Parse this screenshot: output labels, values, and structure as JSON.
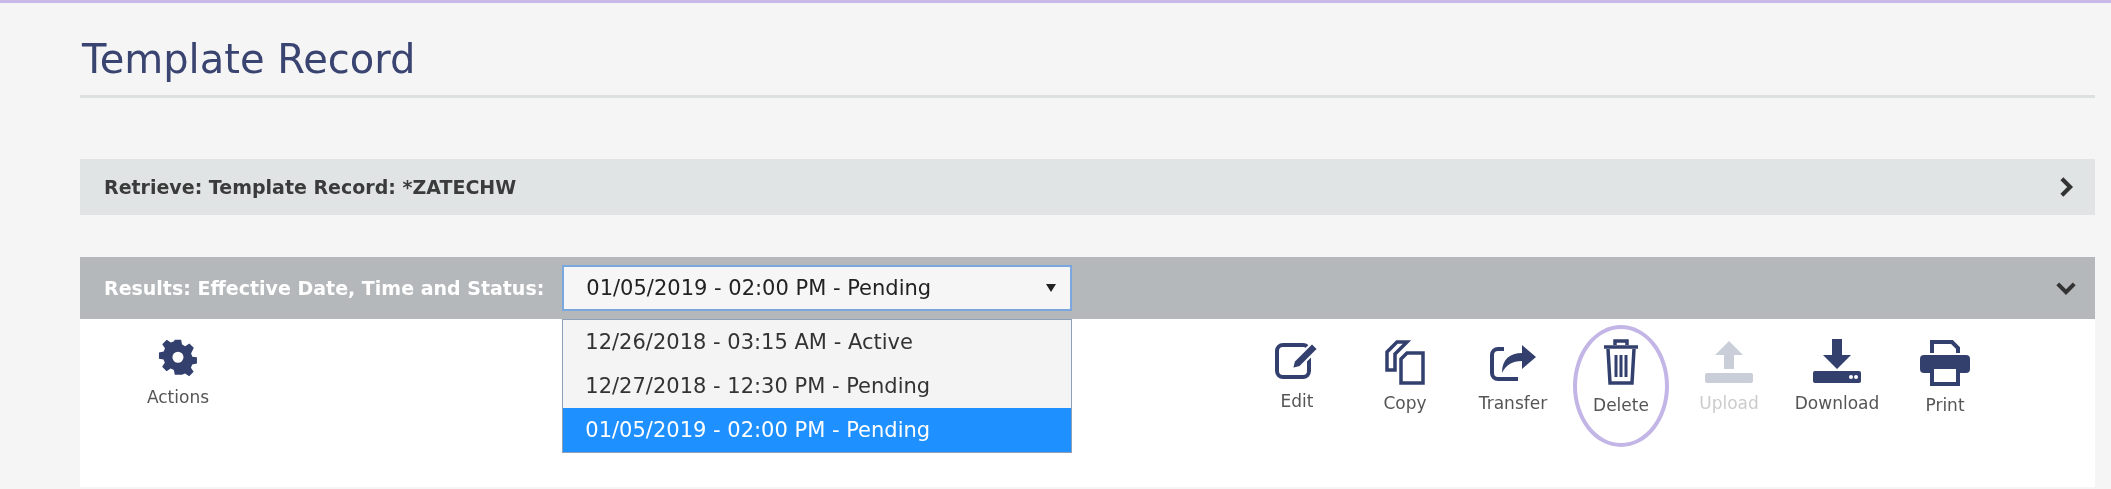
{
  "page": {
    "title": "Template Record"
  },
  "retrieve_panel": {
    "label": "Retrieve: Template Record: *ZATECHW",
    "expanded": false
  },
  "results_panel": {
    "label": "Results: Effective Date, Time and Status:",
    "expanded": true,
    "dropdown": {
      "value": "01/05/2019 - 02:00 PM - Pending",
      "open": true,
      "options": [
        {
          "label": "12/26/2018 - 03:15 AM - Active",
          "selected": false
        },
        {
          "label": "12/27/2018 - 12:30 PM - Pending",
          "selected": false
        },
        {
          "label": "01/05/2019 - 02:00 PM - Pending",
          "selected": true
        }
      ]
    }
  },
  "actions": {
    "label": "Actions"
  },
  "toolbar": [
    {
      "kind": "edit",
      "label": "Edit",
      "disabled": false,
      "circled": false
    },
    {
      "kind": "copy",
      "label": "Copy",
      "disabled": false,
      "circled": false
    },
    {
      "kind": "transfer",
      "label": "Transfer",
      "disabled": false,
      "circled": false
    },
    {
      "kind": "delete",
      "label": "Delete",
      "disabled": false,
      "circled": true
    },
    {
      "kind": "upload",
      "label": "Upload",
      "disabled": true,
      "circled": false
    },
    {
      "kind": "download",
      "label": "Download",
      "disabled": false,
      "circled": false
    },
    {
      "kind": "print",
      "label": "Print",
      "disabled": false,
      "circled": false
    }
  ]
}
